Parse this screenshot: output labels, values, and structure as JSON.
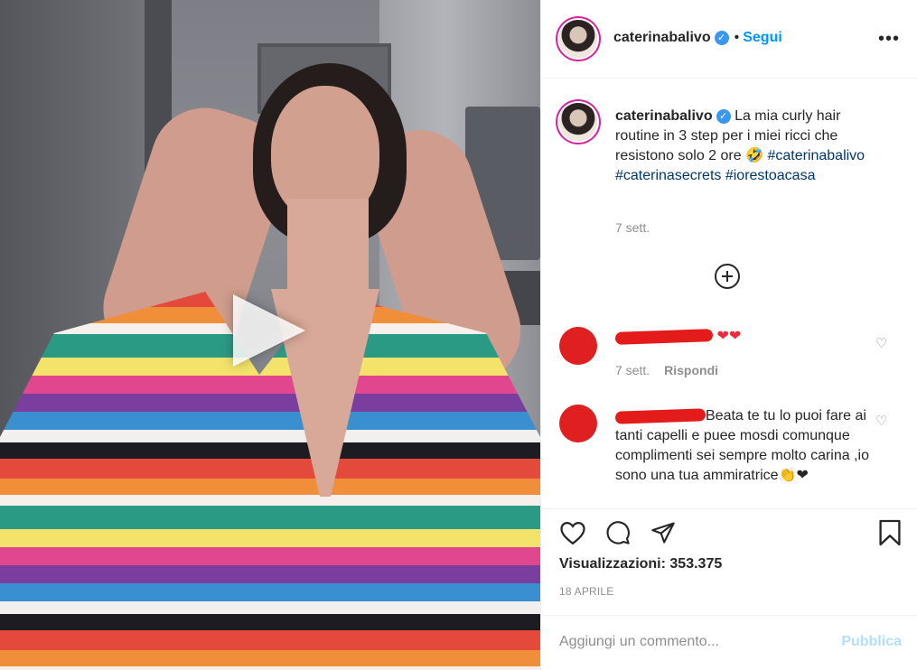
{
  "post": {
    "username": "caterinabalivo",
    "follow_label": "Segui",
    "dot": "•",
    "more_label": "•••"
  },
  "caption": {
    "username": "caterinabalivo",
    "text": "La mia curly hair routine in 3 step per i miei ricci che resistono solo 2 ore 🤣",
    "hashtags": [
      "#caterinabalivo",
      "#caterinasecrets",
      "#iorestoacasa"
    ],
    "time": "7 sett."
  },
  "comments": [
    {
      "text": "❤❤",
      "time": "7 sett.",
      "reply_label": "Rispondi"
    },
    {
      "text": "Beata te tu lo puoi fare ai tanti capelli e puee mosdi comunque complimenti sei sempre molto carina ,io sono una tua ammiratrice👏❤"
    }
  ],
  "stats": {
    "views_label": "Visualizzazioni:",
    "views_value": "353.375",
    "date": "18 APRILE"
  },
  "comment_box": {
    "placeholder": "Aggiungi un commento...",
    "post_label": "Pubblica"
  },
  "colors": {
    "accent": "#0095f6",
    "verified": "#3897f0",
    "hashtag": "#00376b",
    "muted": "#8e8e8e",
    "post_disabled": "#b2dffc",
    "redaction": "#e31b1b"
  },
  "icons": [
    "play-icon",
    "verified-badge-icon",
    "more-options-icon",
    "load-more-icon",
    "heart-icon",
    "comment-icon",
    "share-icon",
    "save-icon"
  ]
}
